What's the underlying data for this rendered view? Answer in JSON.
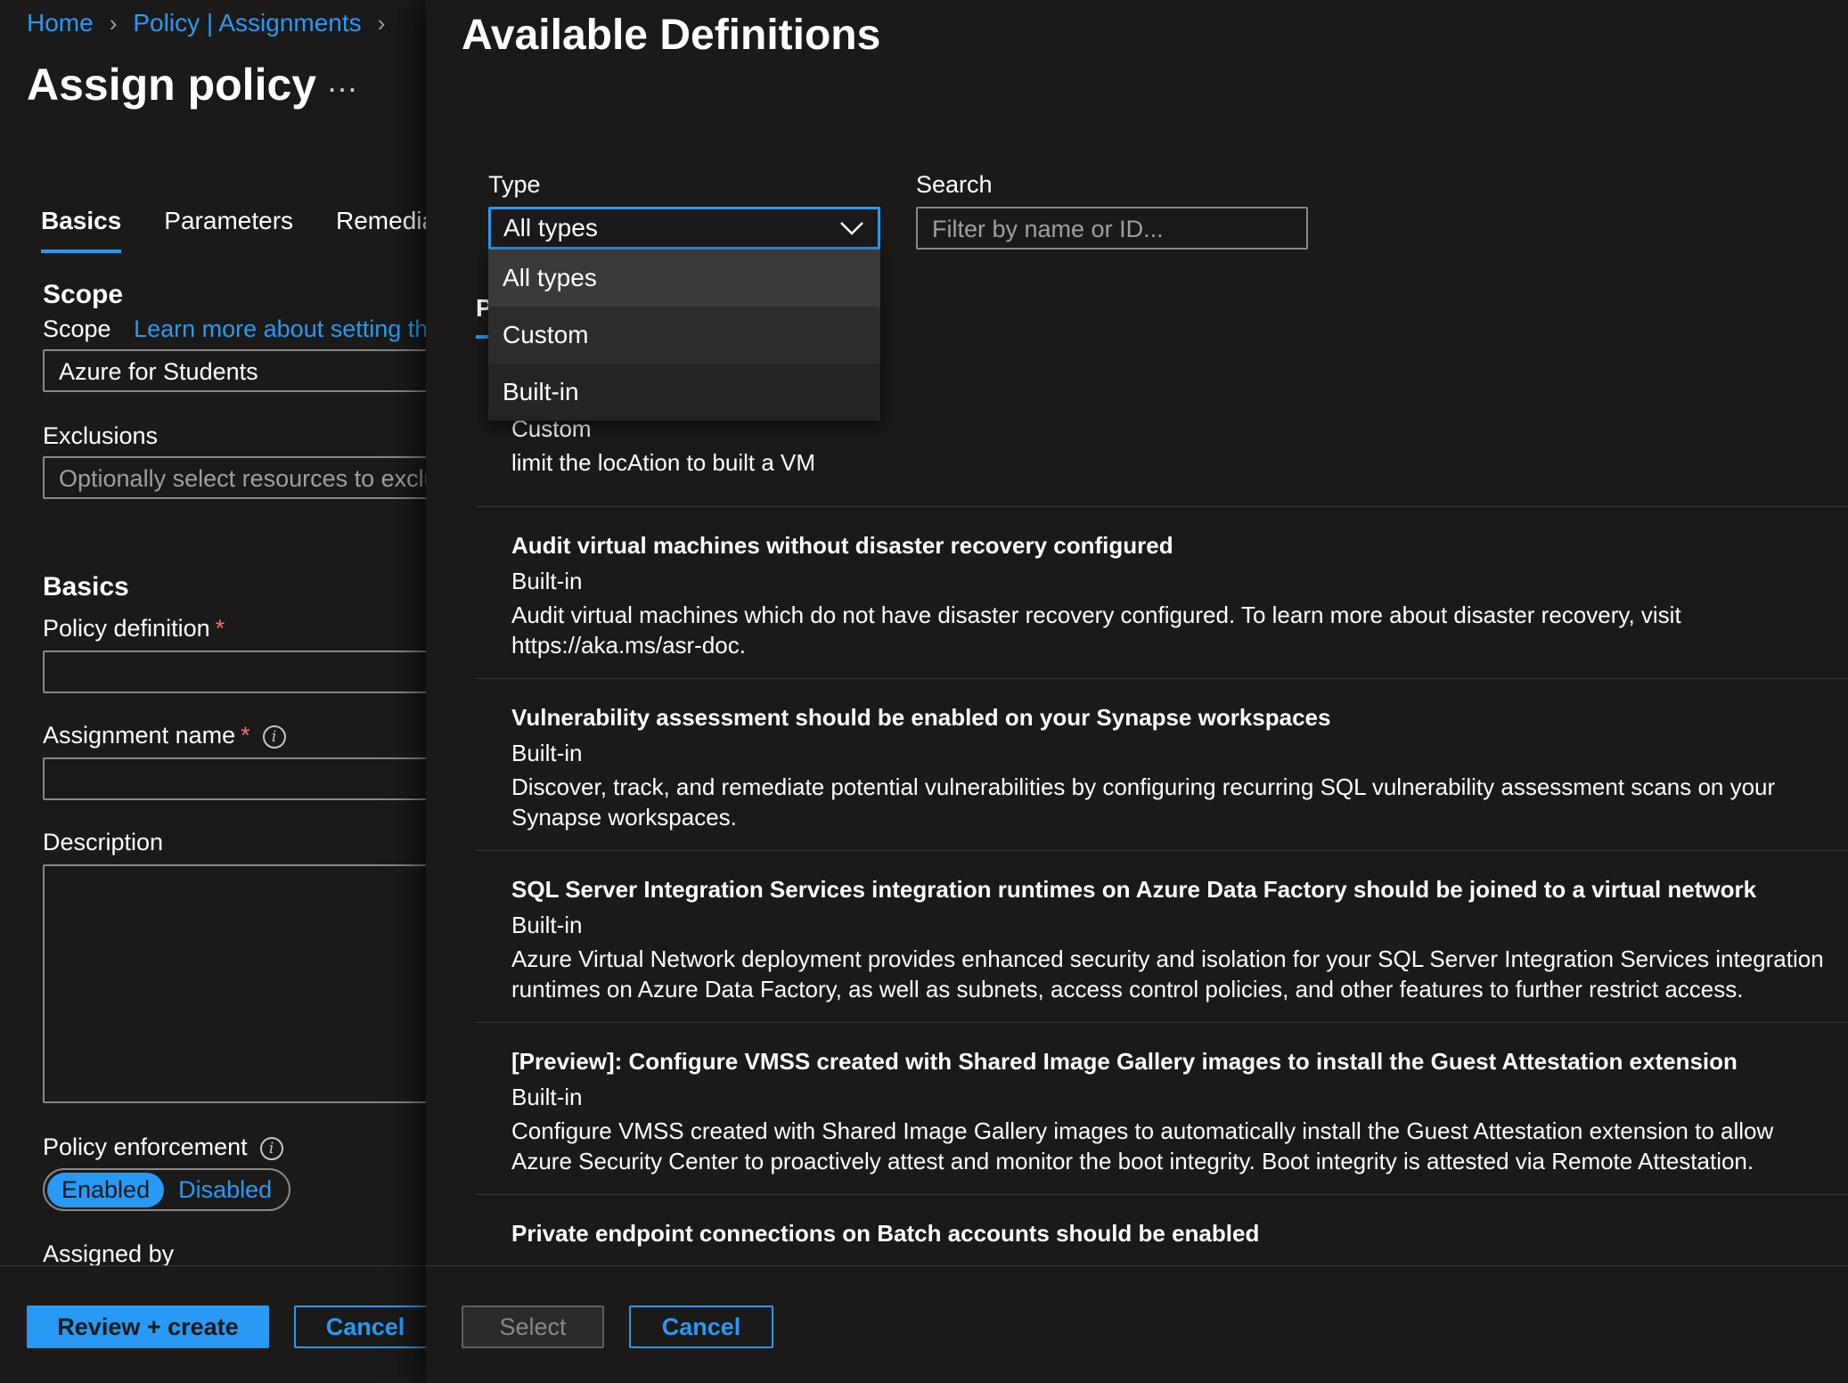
{
  "breadcrumb": {
    "home": "Home",
    "policy_assignments": "Policy | Assignments"
  },
  "blade": {
    "title": "Assign policy",
    "more": "…",
    "tabs": [
      "Basics",
      "Parameters",
      "Remediat"
    ],
    "scope_section": "Scope",
    "scope_label": "Scope",
    "scope_link": "Learn more about setting the",
    "scope_value": "Azure for Students",
    "exclusions_label": "Exclusions",
    "exclusions_placeholder": "Optionally select resources to excluc",
    "basics_section": "Basics",
    "policy_definition_label": "Policy definition",
    "assignment_name_label": "Assignment name",
    "required_mark": "*",
    "info_glyph": "i",
    "description_label": "Description",
    "enforcement_label": "Policy enforcement",
    "enforcement_options": [
      "Enabled",
      "Disabled"
    ],
    "assigned_by_label": "Assigned by",
    "review_create": "Review + create",
    "cancel": "Cancel"
  },
  "panel": {
    "title": "Available Definitions",
    "type_label": "Type",
    "type_value": "All types",
    "type_options": [
      "All types",
      "Custom",
      "Built-in"
    ],
    "search_label": "Search",
    "search_placeholder": "Filter by name or ID...",
    "hidden_tab": "P",
    "definitions": [
      {
        "title": "",
        "type": "Custom",
        "description": "limit the locAtion to built a VM"
      },
      {
        "title": "Audit virtual machines without disaster recovery configured",
        "type": "Built-in",
        "description": "Audit virtual machines which do not have disaster recovery configured. To learn more about disaster recovery, visit https://aka.ms/asr-doc."
      },
      {
        "title": "Vulnerability assessment should be enabled on your Synapse workspaces",
        "type": "Built-in",
        "description": "Discover, track, and remediate potential vulnerabilities by configuring recurring SQL vulnerability assessment scans on your Synapse workspaces."
      },
      {
        "title": "SQL Server Integration Services integration runtimes on Azure Data Factory should be joined to a virtual network",
        "type": "Built-in",
        "description": "Azure Virtual Network deployment provides enhanced security and isolation for your SQL Server Integration Services integration runtimes on Azure Data Factory, as well as subnets, access control policies, and other features to further restrict access."
      },
      {
        "title": "[Preview]: Configure VMSS created with Shared Image Gallery images to install the Guest Attestation extension",
        "type": "Built-in",
        "description": "Configure VMSS created with Shared Image Gallery images to automatically install the Guest Attestation extension to allow Azure Security Center to proactively attest and monitor the boot integrity. Boot integrity is attested via Remote Attestation."
      },
      {
        "title": "Private endpoint connections on Batch accounts should be enabled",
        "type": "",
        "description": ""
      }
    ],
    "select": "Select",
    "cancel": "Cancel"
  },
  "colors": {
    "accent": "#2899f5",
    "background": "#1b1a19",
    "required": "#f1707b"
  }
}
